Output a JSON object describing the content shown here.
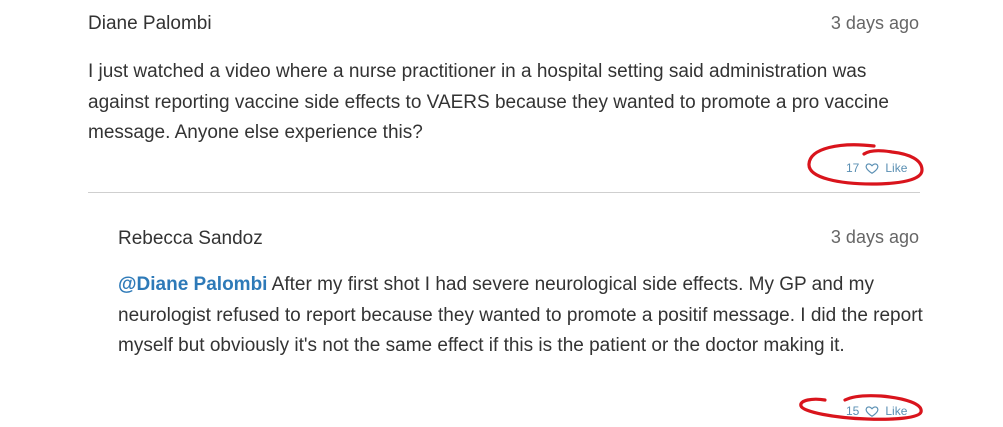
{
  "comments": [
    {
      "author": "Diane Palombi",
      "time": "3 days ago",
      "text": "I just watched a video where a nurse practitioner in a hospital setting said administration was against reporting vaccine side effects to VAERS because they wanted to promote a pro vaccine message. Anyone else experience this?",
      "like_count": "17",
      "like_label": "Like"
    },
    {
      "author": "Rebecca Sandoz",
      "time": "3 days ago",
      "mention": "@Diane Palombi",
      "text": " After my first shot I had severe neurological side effects. My GP and my neurologist refused to report because they wanted to promote a positif message. I did the report myself but obviously it's not the same effect if this is the patient or the doctor making it.",
      "like_count": "15",
      "like_label": "Like"
    }
  ],
  "colors": {
    "mention": "#2e7ab8",
    "like_text": "#5a8fb3",
    "annotation_circle": "#d9141c"
  },
  "icons": {
    "like": "heart-outline-icon"
  }
}
